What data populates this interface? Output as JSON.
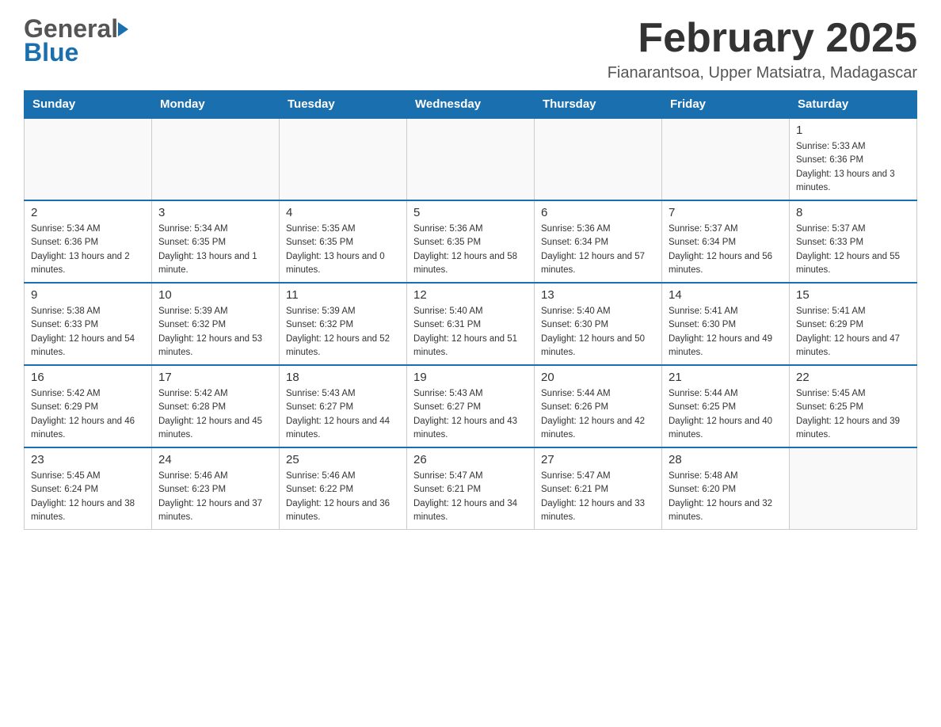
{
  "header": {
    "month_title": "February 2025",
    "location": "Fianarantsoa, Upper Matsiatra, Madagascar",
    "logo_general": "General",
    "logo_blue": "Blue"
  },
  "days_of_week": [
    "Sunday",
    "Monday",
    "Tuesday",
    "Wednesday",
    "Thursday",
    "Friday",
    "Saturday"
  ],
  "weeks": [
    [
      {
        "day": "",
        "info": ""
      },
      {
        "day": "",
        "info": ""
      },
      {
        "day": "",
        "info": ""
      },
      {
        "day": "",
        "info": ""
      },
      {
        "day": "",
        "info": ""
      },
      {
        "day": "",
        "info": ""
      },
      {
        "day": "1",
        "info": "Sunrise: 5:33 AM\nSunset: 6:36 PM\nDaylight: 13 hours and 3 minutes."
      }
    ],
    [
      {
        "day": "2",
        "info": "Sunrise: 5:34 AM\nSunset: 6:36 PM\nDaylight: 13 hours and 2 minutes."
      },
      {
        "day": "3",
        "info": "Sunrise: 5:34 AM\nSunset: 6:35 PM\nDaylight: 13 hours and 1 minute."
      },
      {
        "day": "4",
        "info": "Sunrise: 5:35 AM\nSunset: 6:35 PM\nDaylight: 13 hours and 0 minutes."
      },
      {
        "day": "5",
        "info": "Sunrise: 5:36 AM\nSunset: 6:35 PM\nDaylight: 12 hours and 58 minutes."
      },
      {
        "day": "6",
        "info": "Sunrise: 5:36 AM\nSunset: 6:34 PM\nDaylight: 12 hours and 57 minutes."
      },
      {
        "day": "7",
        "info": "Sunrise: 5:37 AM\nSunset: 6:34 PM\nDaylight: 12 hours and 56 minutes."
      },
      {
        "day": "8",
        "info": "Sunrise: 5:37 AM\nSunset: 6:33 PM\nDaylight: 12 hours and 55 minutes."
      }
    ],
    [
      {
        "day": "9",
        "info": "Sunrise: 5:38 AM\nSunset: 6:33 PM\nDaylight: 12 hours and 54 minutes."
      },
      {
        "day": "10",
        "info": "Sunrise: 5:39 AM\nSunset: 6:32 PM\nDaylight: 12 hours and 53 minutes."
      },
      {
        "day": "11",
        "info": "Sunrise: 5:39 AM\nSunset: 6:32 PM\nDaylight: 12 hours and 52 minutes."
      },
      {
        "day": "12",
        "info": "Sunrise: 5:40 AM\nSunset: 6:31 PM\nDaylight: 12 hours and 51 minutes."
      },
      {
        "day": "13",
        "info": "Sunrise: 5:40 AM\nSunset: 6:30 PM\nDaylight: 12 hours and 50 minutes."
      },
      {
        "day": "14",
        "info": "Sunrise: 5:41 AM\nSunset: 6:30 PM\nDaylight: 12 hours and 49 minutes."
      },
      {
        "day": "15",
        "info": "Sunrise: 5:41 AM\nSunset: 6:29 PM\nDaylight: 12 hours and 47 minutes."
      }
    ],
    [
      {
        "day": "16",
        "info": "Sunrise: 5:42 AM\nSunset: 6:29 PM\nDaylight: 12 hours and 46 minutes."
      },
      {
        "day": "17",
        "info": "Sunrise: 5:42 AM\nSunset: 6:28 PM\nDaylight: 12 hours and 45 minutes."
      },
      {
        "day": "18",
        "info": "Sunrise: 5:43 AM\nSunset: 6:27 PM\nDaylight: 12 hours and 44 minutes."
      },
      {
        "day": "19",
        "info": "Sunrise: 5:43 AM\nSunset: 6:27 PM\nDaylight: 12 hours and 43 minutes."
      },
      {
        "day": "20",
        "info": "Sunrise: 5:44 AM\nSunset: 6:26 PM\nDaylight: 12 hours and 42 minutes."
      },
      {
        "day": "21",
        "info": "Sunrise: 5:44 AM\nSunset: 6:25 PM\nDaylight: 12 hours and 40 minutes."
      },
      {
        "day": "22",
        "info": "Sunrise: 5:45 AM\nSunset: 6:25 PM\nDaylight: 12 hours and 39 minutes."
      }
    ],
    [
      {
        "day": "23",
        "info": "Sunrise: 5:45 AM\nSunset: 6:24 PM\nDaylight: 12 hours and 38 minutes."
      },
      {
        "day": "24",
        "info": "Sunrise: 5:46 AM\nSunset: 6:23 PM\nDaylight: 12 hours and 37 minutes."
      },
      {
        "day": "25",
        "info": "Sunrise: 5:46 AM\nSunset: 6:22 PM\nDaylight: 12 hours and 36 minutes."
      },
      {
        "day": "26",
        "info": "Sunrise: 5:47 AM\nSunset: 6:21 PM\nDaylight: 12 hours and 34 minutes."
      },
      {
        "day": "27",
        "info": "Sunrise: 5:47 AM\nSunset: 6:21 PM\nDaylight: 12 hours and 33 minutes."
      },
      {
        "day": "28",
        "info": "Sunrise: 5:48 AM\nSunset: 6:20 PM\nDaylight: 12 hours and 32 minutes."
      },
      {
        "day": "",
        "info": ""
      }
    ]
  ]
}
